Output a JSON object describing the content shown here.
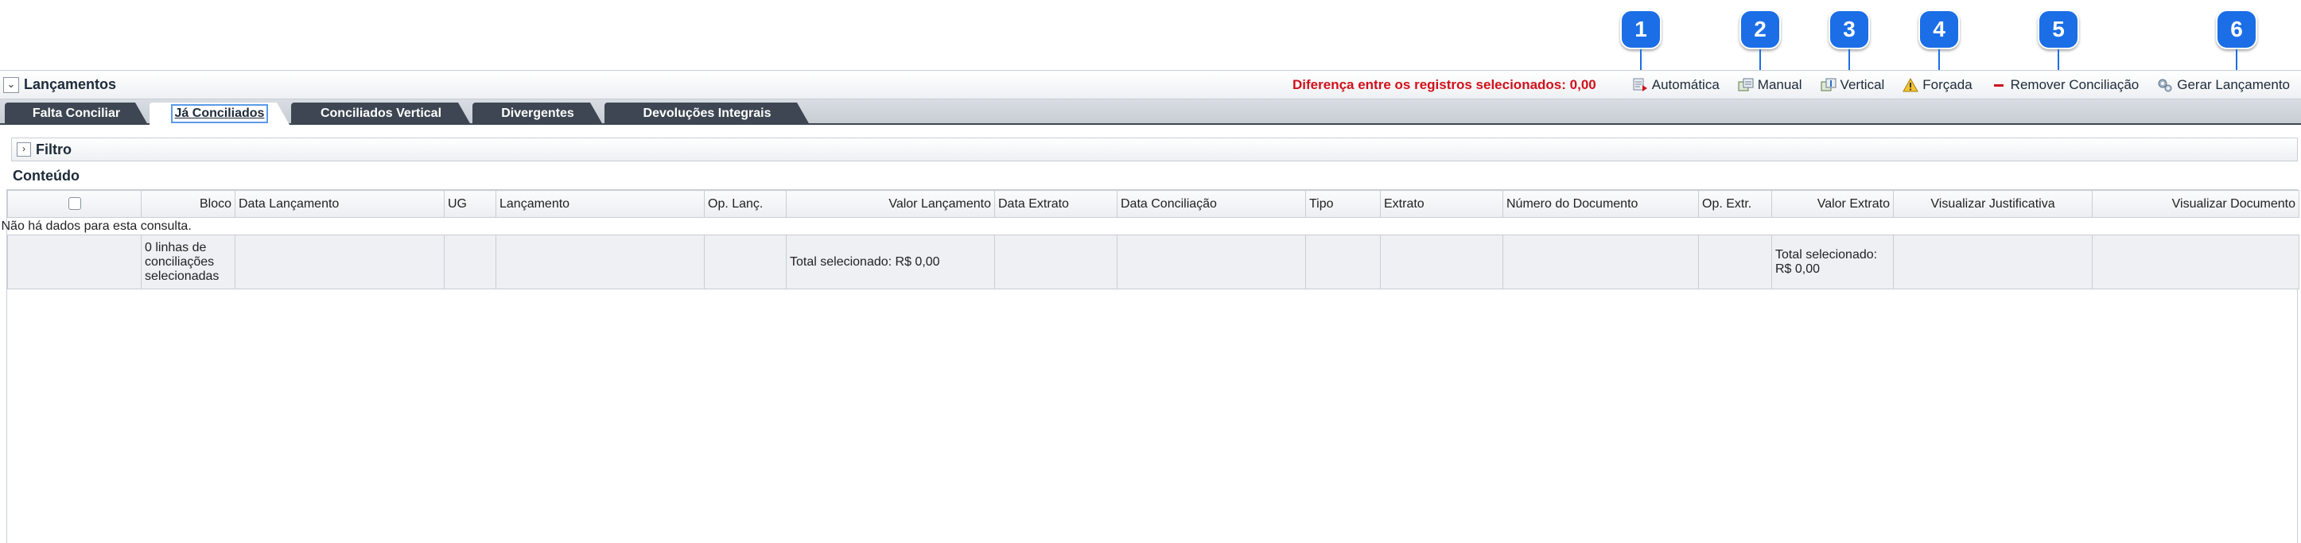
{
  "callouts": [
    "1",
    "2",
    "3",
    "4",
    "5",
    "6"
  ],
  "header": {
    "toggle_glyph": "⌄",
    "title": "Lançamentos",
    "difference_text": "Diferença entre os registros selecionados: 0,00"
  },
  "toolbar": {
    "items": [
      {
        "label": "Automática",
        "icon": "automatic-reconcile-icon"
      },
      {
        "label": "Manual",
        "icon": "manual-reconcile-icon"
      },
      {
        "label": "Vertical",
        "icon": "vertical-reconcile-icon"
      },
      {
        "label": "Forçada",
        "icon": "warning-icon"
      },
      {
        "label": "Remover Conciliação",
        "icon": "remove-icon"
      },
      {
        "label": "Gerar Lançamento",
        "icon": "gears-icon"
      }
    ]
  },
  "tabs": [
    {
      "label": "Falta Conciliar",
      "active": false
    },
    {
      "label": "Já Conciliados",
      "active": true
    },
    {
      "label": "Conciliados Vertical",
      "active": false
    },
    {
      "label": "Divergentes",
      "active": false
    },
    {
      "label": "Devoluções Integrais",
      "active": false
    }
  ],
  "filter": {
    "toggle_glyph": "›",
    "label": "Filtro"
  },
  "content": {
    "title": "Conteúdo"
  },
  "grid": {
    "columns": [
      "",
      "Bloco",
      "Data Lançamento",
      "UG",
      "Lançamento",
      "Op. Lanç.",
      "Valor Lançamento",
      "Data Extrato",
      "Data Conciliação",
      "Tipo",
      "Extrato",
      "Número do Documento",
      "Op. Extr.",
      "Valor Extrato",
      "Visualizar Justificativa",
      "Visualizar Documento"
    ],
    "empty_message": "Não há dados para esta consulta.",
    "summary": {
      "rows_selected": "0 linhas de conciliações selecionadas",
      "total_lancamento": "Total selecionado: R$ 0,00",
      "total_extrato": "Total selecionado: R$ 0,00"
    }
  },
  "colors": {
    "accent": "#1b6ee6",
    "difference": "#d0121b",
    "tab_dark": "#3d4652"
  }
}
